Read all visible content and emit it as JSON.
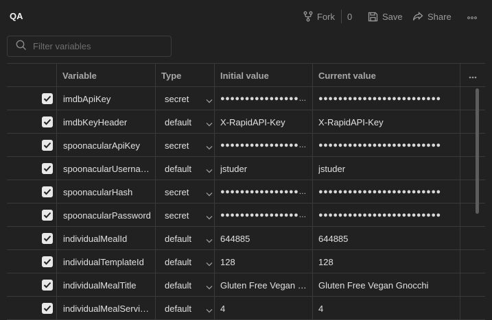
{
  "header": {
    "title": "QA",
    "fork_label": "Fork",
    "fork_count": "0",
    "save_label": "Save",
    "share_label": "Share"
  },
  "filter": {
    "placeholder": "Filter variables"
  },
  "table": {
    "columns": [
      "Variable",
      "Type",
      "Initial value",
      "Current value"
    ]
  },
  "rows": [
    {
      "variable": "imdbApiKey",
      "type": "secret",
      "initial": "●●●●●●●●●●●●●●●●●●●●●●●●●",
      "current": "●●●●●●●●●●●●●●●●●●●●●●●●●",
      "checked": true
    },
    {
      "variable": "imdbKeyHeader",
      "type": "default",
      "initial": "X-RapidAPI-Key",
      "current": "X-RapidAPI-Key",
      "checked": true
    },
    {
      "variable": "spoonacularApiKey",
      "type": "secret",
      "initial": "●●●●●●●●●●●●●●●●●●●●●●●●●",
      "current": "●●●●●●●●●●●●●●●●●●●●●●●●●",
      "checked": true
    },
    {
      "variable": "spoonacularUsername",
      "type": "default",
      "initial": "jstuder",
      "current": "jstuder",
      "checked": true
    },
    {
      "variable": "spoonacularHash",
      "type": "secret",
      "initial": "●●●●●●●●●●●●●●●●●●●●●●●●●",
      "current": "●●●●●●●●●●●●●●●●●●●●●●●●●",
      "checked": true
    },
    {
      "variable": "spoonacularPassword",
      "type": "secret",
      "initial": "●●●●●●●●●●●●●●●●●●●●●●●●●",
      "current": "●●●●●●●●●●●●●●●●●●●●●●●●●",
      "checked": true
    },
    {
      "variable": "individualMealId",
      "type": "default",
      "initial": "644885",
      "current": "644885",
      "checked": true
    },
    {
      "variable": "individualTemplateId",
      "type": "default",
      "initial": "128",
      "current": "128",
      "checked": true
    },
    {
      "variable": "individualMealTitle",
      "type": "default",
      "initial": "Gluten Free Vegan Gnocchi",
      "current": "Gluten Free Vegan Gnocchi",
      "checked": true
    },
    {
      "variable": "individualMealServings",
      "type": "default",
      "initial": "4",
      "current": "4",
      "checked": true
    }
  ]
}
